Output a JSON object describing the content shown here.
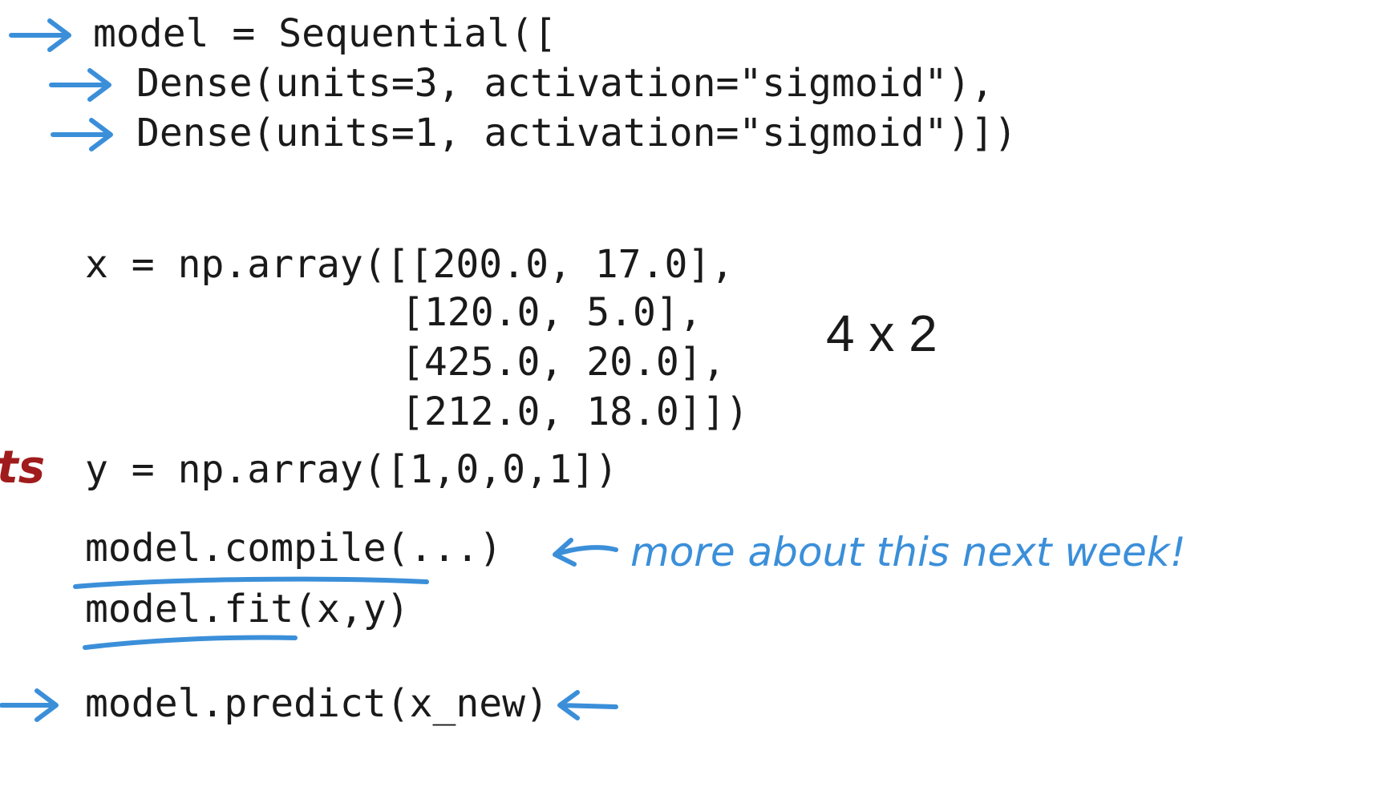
{
  "code": {
    "model_line": "model = Sequential([",
    "dense1_line": "Dense(units=3, activation=\"sigmoid\"),",
    "dense2_line": "Dense(units=1, activation=\"sigmoid\")])",
    "x_lines": [
      "x = np.array([[200.0, 17.0],",
      "[120.0, 5.0],",
      "[425.0, 20.0],",
      "[212.0, 18.0]])"
    ],
    "y_line": "y = np.array([1,0,0,1])",
    "compile_line": "model.compile(...)",
    "fit_line": "model.fit(x,y)",
    "predict_line": "model.predict(x_new)"
  },
  "annotations": {
    "shape_label": "4 x 2",
    "clipped_red_text": "ts",
    "compile_note": "more about this next week!"
  },
  "colors": {
    "ink_blue": "#3b8fd9",
    "ink_red": "#a01c1c",
    "code_text": "#1a1a1a"
  }
}
